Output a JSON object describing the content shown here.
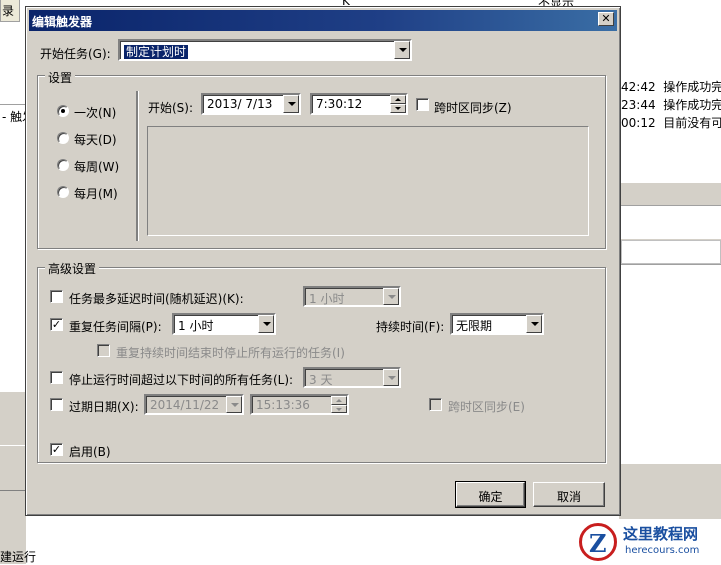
{
  "background": {
    "tab_label": "录",
    "top_text_1": "K°",
    "top_text_2": "不显示",
    "left_text": "- 触发",
    "bottom_left_text": "建运行",
    "log_rows": [
      {
        "time": "42:42",
        "msg": "操作成功完"
      },
      {
        "time": "23:44",
        "msg": "操作成功完"
      },
      {
        "time": "00:12",
        "msg": "目前没有可"
      }
    ]
  },
  "dialog": {
    "title": "编辑触发器",
    "close_glyph": "✕",
    "start_task_label": "开始任务(G):",
    "start_task_value": "制定计划时",
    "settings": {
      "title": "设置",
      "radios": [
        {
          "label": "一次(N)",
          "checked": true
        },
        {
          "label": "每天(D)",
          "checked": false
        },
        {
          "label": "每周(W)",
          "checked": false
        },
        {
          "label": "每月(M)",
          "checked": false
        }
      ],
      "start_label": "开始(S):",
      "start_date": "2013/ 7/13",
      "start_time": "7:30:12",
      "sync_timezone_label": "跨时区同步(Z)"
    },
    "advanced": {
      "title": "高级设置",
      "delay_label": "任务最多延迟时间(随机延迟)(K):",
      "delay_value": "1 小时",
      "repeat_label": "重复任务间隔(P):",
      "repeat_value": "1 小时",
      "duration_label": "持续时间(F):",
      "duration_value": "无限期",
      "stop_at_end_label": "重复持续时间结束时停止所有运行的任务(I)",
      "stop_if_runs_label": "停止运行时间超过以下时间的所有任务(L):",
      "stop_if_runs_value": "3 天",
      "expire_label": "过期日期(X):",
      "expire_date": "2014/11/22",
      "expire_time": "15:13:36",
      "expire_sync_label": "跨时区同步(E)",
      "enabled_label": "启用(B)",
      "check_glyph": "✓"
    },
    "ok_label": "确定",
    "cancel_label": "取消"
  },
  "watermark": {
    "logo_letter": "Z",
    "title": "这里教程网",
    "url": "herecours.com"
  }
}
